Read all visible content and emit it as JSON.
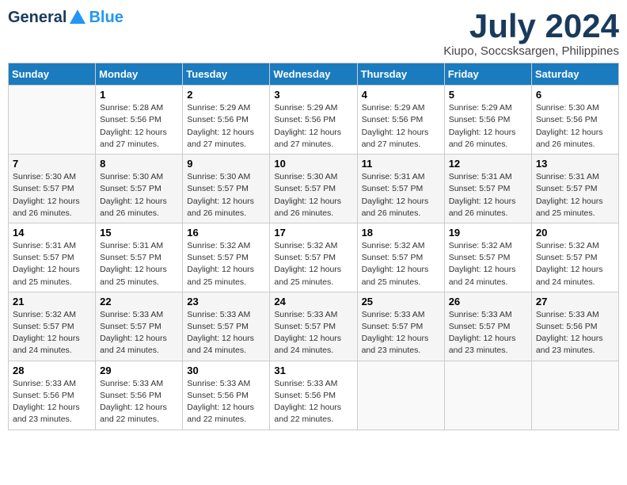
{
  "header": {
    "logo": {
      "general": "General",
      "blue": "Blue"
    },
    "title": "July 2024",
    "location": "Kiupo, Soccsksargen, Philippines"
  },
  "weekdays": [
    "Sunday",
    "Monday",
    "Tuesday",
    "Wednesday",
    "Thursday",
    "Friday",
    "Saturday"
  ],
  "weeks": [
    [
      {
        "day": null,
        "info": null
      },
      {
        "day": "1",
        "info": "Sunrise: 5:28 AM\nSunset: 5:56 PM\nDaylight: 12 hours\nand 27 minutes."
      },
      {
        "day": "2",
        "info": "Sunrise: 5:29 AM\nSunset: 5:56 PM\nDaylight: 12 hours\nand 27 minutes."
      },
      {
        "day": "3",
        "info": "Sunrise: 5:29 AM\nSunset: 5:56 PM\nDaylight: 12 hours\nand 27 minutes."
      },
      {
        "day": "4",
        "info": "Sunrise: 5:29 AM\nSunset: 5:56 PM\nDaylight: 12 hours\nand 27 minutes."
      },
      {
        "day": "5",
        "info": "Sunrise: 5:29 AM\nSunset: 5:56 PM\nDaylight: 12 hours\nand 26 minutes."
      },
      {
        "day": "6",
        "info": "Sunrise: 5:30 AM\nSunset: 5:56 PM\nDaylight: 12 hours\nand 26 minutes."
      }
    ],
    [
      {
        "day": "7",
        "info": "Sunrise: 5:30 AM\nSunset: 5:57 PM\nDaylight: 12 hours\nand 26 minutes."
      },
      {
        "day": "8",
        "info": "Sunrise: 5:30 AM\nSunset: 5:57 PM\nDaylight: 12 hours\nand 26 minutes."
      },
      {
        "day": "9",
        "info": "Sunrise: 5:30 AM\nSunset: 5:57 PM\nDaylight: 12 hours\nand 26 minutes."
      },
      {
        "day": "10",
        "info": "Sunrise: 5:30 AM\nSunset: 5:57 PM\nDaylight: 12 hours\nand 26 minutes."
      },
      {
        "day": "11",
        "info": "Sunrise: 5:31 AM\nSunset: 5:57 PM\nDaylight: 12 hours\nand 26 minutes."
      },
      {
        "day": "12",
        "info": "Sunrise: 5:31 AM\nSunset: 5:57 PM\nDaylight: 12 hours\nand 26 minutes."
      },
      {
        "day": "13",
        "info": "Sunrise: 5:31 AM\nSunset: 5:57 PM\nDaylight: 12 hours\nand 25 minutes."
      }
    ],
    [
      {
        "day": "14",
        "info": "Sunrise: 5:31 AM\nSunset: 5:57 PM\nDaylight: 12 hours\nand 25 minutes."
      },
      {
        "day": "15",
        "info": "Sunrise: 5:31 AM\nSunset: 5:57 PM\nDaylight: 12 hours\nand 25 minutes."
      },
      {
        "day": "16",
        "info": "Sunrise: 5:32 AM\nSunset: 5:57 PM\nDaylight: 12 hours\nand 25 minutes."
      },
      {
        "day": "17",
        "info": "Sunrise: 5:32 AM\nSunset: 5:57 PM\nDaylight: 12 hours\nand 25 minutes."
      },
      {
        "day": "18",
        "info": "Sunrise: 5:32 AM\nSunset: 5:57 PM\nDaylight: 12 hours\nand 25 minutes."
      },
      {
        "day": "19",
        "info": "Sunrise: 5:32 AM\nSunset: 5:57 PM\nDaylight: 12 hours\nand 24 minutes."
      },
      {
        "day": "20",
        "info": "Sunrise: 5:32 AM\nSunset: 5:57 PM\nDaylight: 12 hours\nand 24 minutes."
      }
    ],
    [
      {
        "day": "21",
        "info": "Sunrise: 5:32 AM\nSunset: 5:57 PM\nDaylight: 12 hours\nand 24 minutes."
      },
      {
        "day": "22",
        "info": "Sunrise: 5:33 AM\nSunset: 5:57 PM\nDaylight: 12 hours\nand 24 minutes."
      },
      {
        "day": "23",
        "info": "Sunrise: 5:33 AM\nSunset: 5:57 PM\nDaylight: 12 hours\nand 24 minutes."
      },
      {
        "day": "24",
        "info": "Sunrise: 5:33 AM\nSunset: 5:57 PM\nDaylight: 12 hours\nand 24 minutes."
      },
      {
        "day": "25",
        "info": "Sunrise: 5:33 AM\nSunset: 5:57 PM\nDaylight: 12 hours\nand 23 minutes."
      },
      {
        "day": "26",
        "info": "Sunrise: 5:33 AM\nSunset: 5:57 PM\nDaylight: 12 hours\nand 23 minutes."
      },
      {
        "day": "27",
        "info": "Sunrise: 5:33 AM\nSunset: 5:56 PM\nDaylight: 12 hours\nand 23 minutes."
      }
    ],
    [
      {
        "day": "28",
        "info": "Sunrise: 5:33 AM\nSunset: 5:56 PM\nDaylight: 12 hours\nand 23 minutes."
      },
      {
        "day": "29",
        "info": "Sunrise: 5:33 AM\nSunset: 5:56 PM\nDaylight: 12 hours\nand 22 minutes."
      },
      {
        "day": "30",
        "info": "Sunrise: 5:33 AM\nSunset: 5:56 PM\nDaylight: 12 hours\nand 22 minutes."
      },
      {
        "day": "31",
        "info": "Sunrise: 5:33 AM\nSunset: 5:56 PM\nDaylight: 12 hours\nand 22 minutes."
      },
      {
        "day": null,
        "info": null
      },
      {
        "day": null,
        "info": null
      },
      {
        "day": null,
        "info": null
      }
    ]
  ]
}
